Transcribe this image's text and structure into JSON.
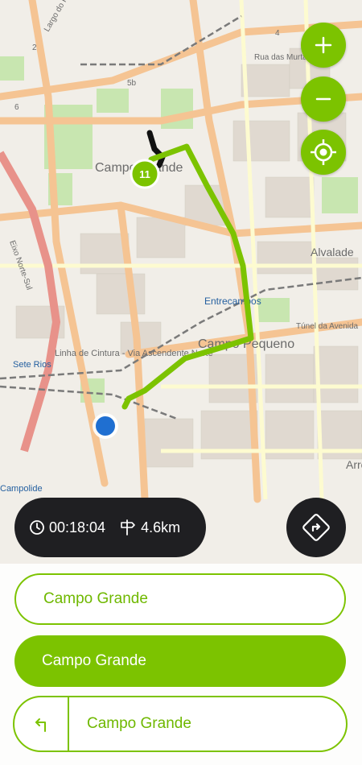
{
  "map": {
    "places": [
      "Campo Grande",
      "Campo Pequeno",
      "Entrecampos",
      "Alvalade",
      "Sete Rios",
      "Linha de Cintura - Via Ascendente Norte",
      "Túnel da Avenida",
      "Rua das Murtas",
      "Eixo Norte-Sul",
      "Largo do Padre Cruz",
      "Arroios",
      "Campolide"
    ],
    "roads": [
      "5b",
      "6",
      "4",
      "2"
    ],
    "waypoint_count": "11",
    "route_color": "#7cc300",
    "location_color": "#1f6fd1"
  },
  "controls": {
    "zoom_in_icon": "plus-icon",
    "zoom_out_icon": "minus-icon",
    "locate_icon": "crosshair-icon",
    "navigate_icon": "directions-icon"
  },
  "trip": {
    "duration": "00:18:04",
    "distance": "4.6km",
    "duration_icon": "clock-icon",
    "distance_icon": "signpost-icon"
  },
  "destinations": {
    "first": "Campo Grande",
    "second": "Campo Grande",
    "turn_label": "Campo Grande",
    "turn_icon": "turn-left-icon"
  },
  "colors": {
    "accent": "#7cc300",
    "dark": "#1f1f22"
  }
}
